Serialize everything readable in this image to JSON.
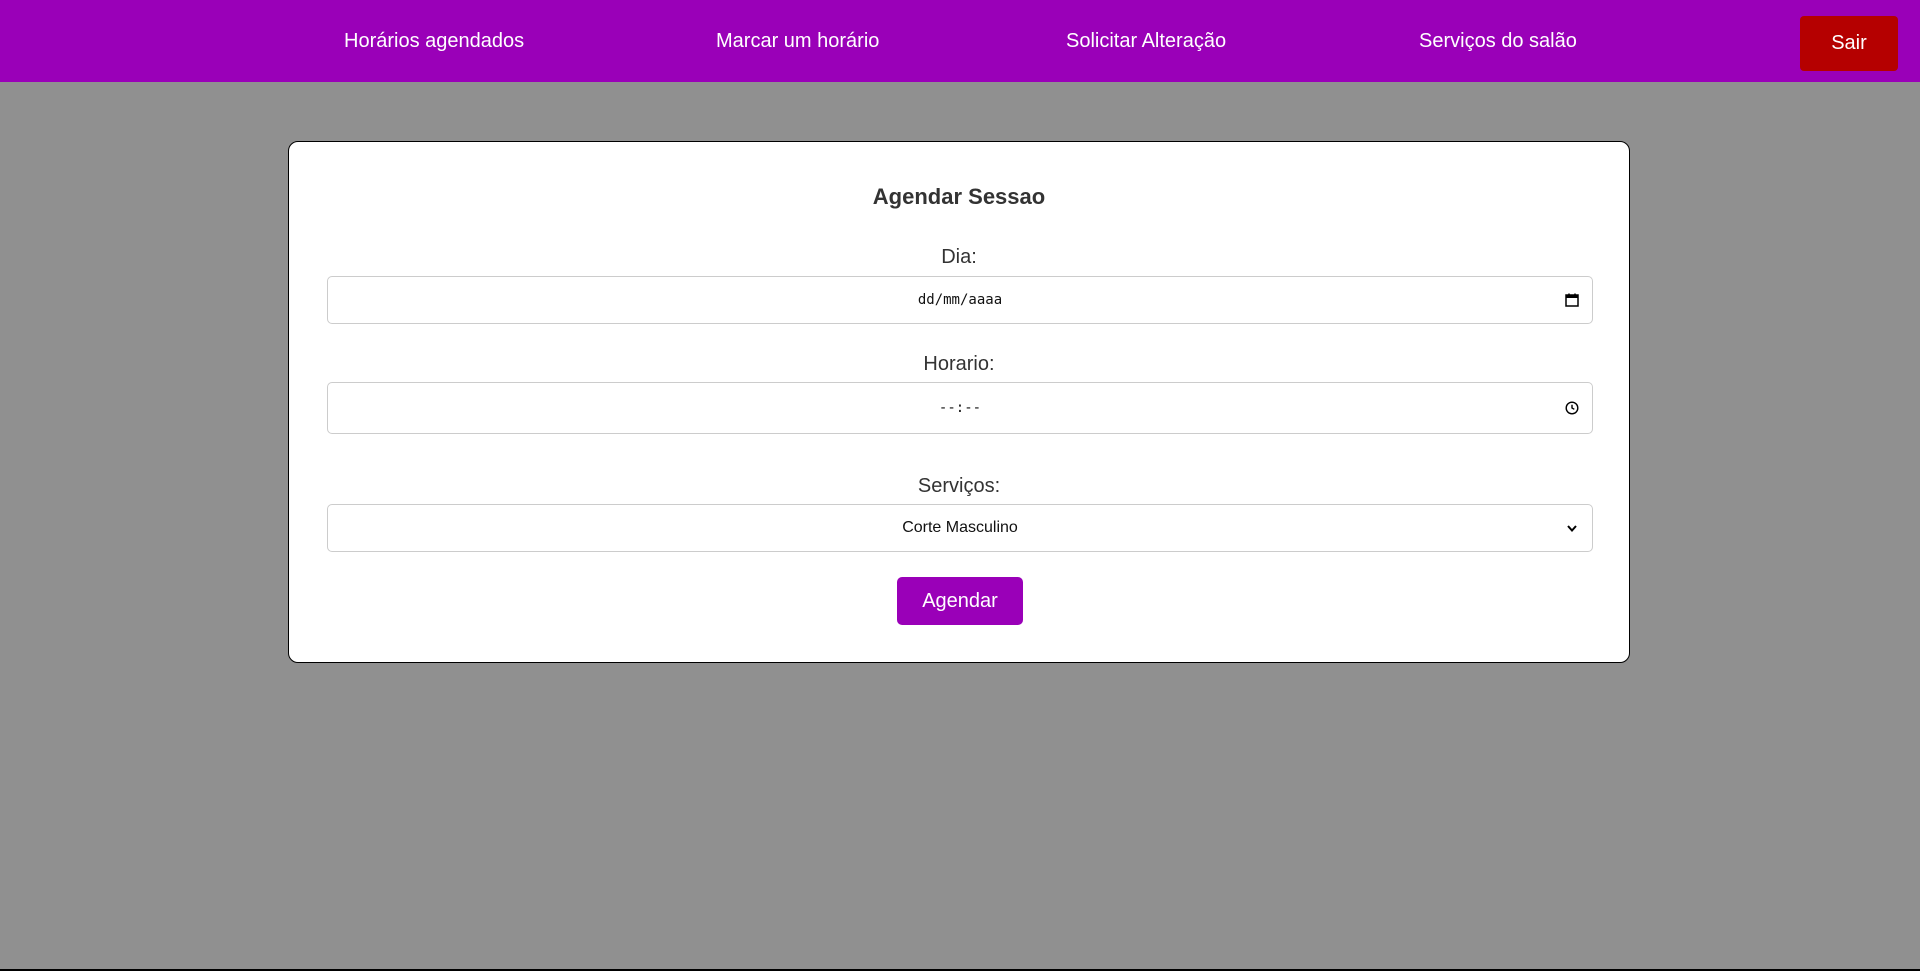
{
  "nav": {
    "items": [
      {
        "label": "Horários agendados"
      },
      {
        "label": "Marcar um horário"
      },
      {
        "label": "Solicitar Alteração"
      },
      {
        "label": "Serviços do salão"
      }
    ],
    "logout_label": "Sair"
  },
  "form": {
    "title": "Agendar Sessao",
    "day": {
      "label": "Dia:",
      "placeholder": "dd/mm/aaaa",
      "icon": "calendar-icon"
    },
    "time": {
      "label": "Horario:",
      "placeholder": "--:--",
      "icon": "clock-icon"
    },
    "service": {
      "label": "Serviços:",
      "selected": "Corte Masculino",
      "icon": "chevron-down-icon"
    },
    "submit_label": "Agendar"
  },
  "colors": {
    "header": "#9a00b8",
    "logout": "#b50000",
    "background": "#909090",
    "submit": "#9a00b8"
  }
}
